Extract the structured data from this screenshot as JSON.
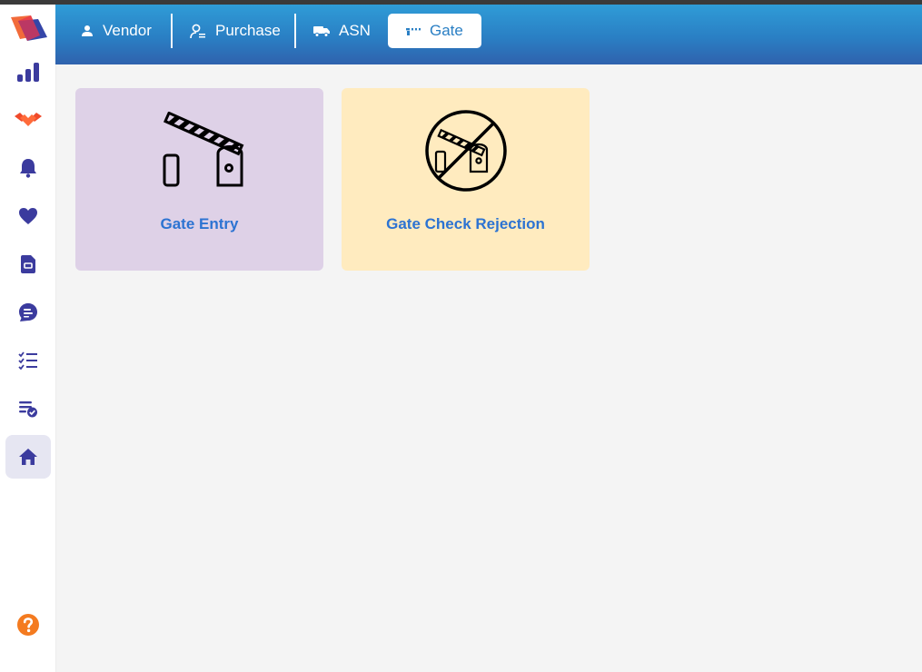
{
  "tabs": [
    {
      "label": "Vendor",
      "icon": "person-icon"
    },
    {
      "label": "Purchase",
      "icon": "person-list-icon"
    },
    {
      "label": "ASN",
      "icon": "truck-icon"
    },
    {
      "label": "Gate",
      "icon": "gate-barrier-icon",
      "active": true
    }
  ],
  "sidebar": {
    "logo": "app-logo",
    "items": [
      {
        "name": "bar-chart-icon"
      },
      {
        "name": "handshake-icon"
      },
      {
        "name": "bell-icon"
      },
      {
        "name": "heart-icon"
      },
      {
        "name": "document-icon"
      },
      {
        "name": "message-icon"
      },
      {
        "name": "checklist-icon"
      },
      {
        "name": "list-check-icon"
      },
      {
        "name": "home-icon",
        "active": true
      }
    ],
    "help": "help-icon"
  },
  "cards": [
    {
      "label": "Gate Entry",
      "icon": "gate-barrier-icon",
      "bg": "#ded1e7"
    },
    {
      "label": "Gate Check Rejection",
      "icon": "gate-rejected-icon",
      "bg": "#ffebbf"
    }
  ],
  "colors": {
    "topbar_start": "#2f9cd7",
    "topbar_end": "#2f62ad",
    "accent_text": "#2c73d2",
    "sidebar_icon": "#3b3b9e"
  }
}
